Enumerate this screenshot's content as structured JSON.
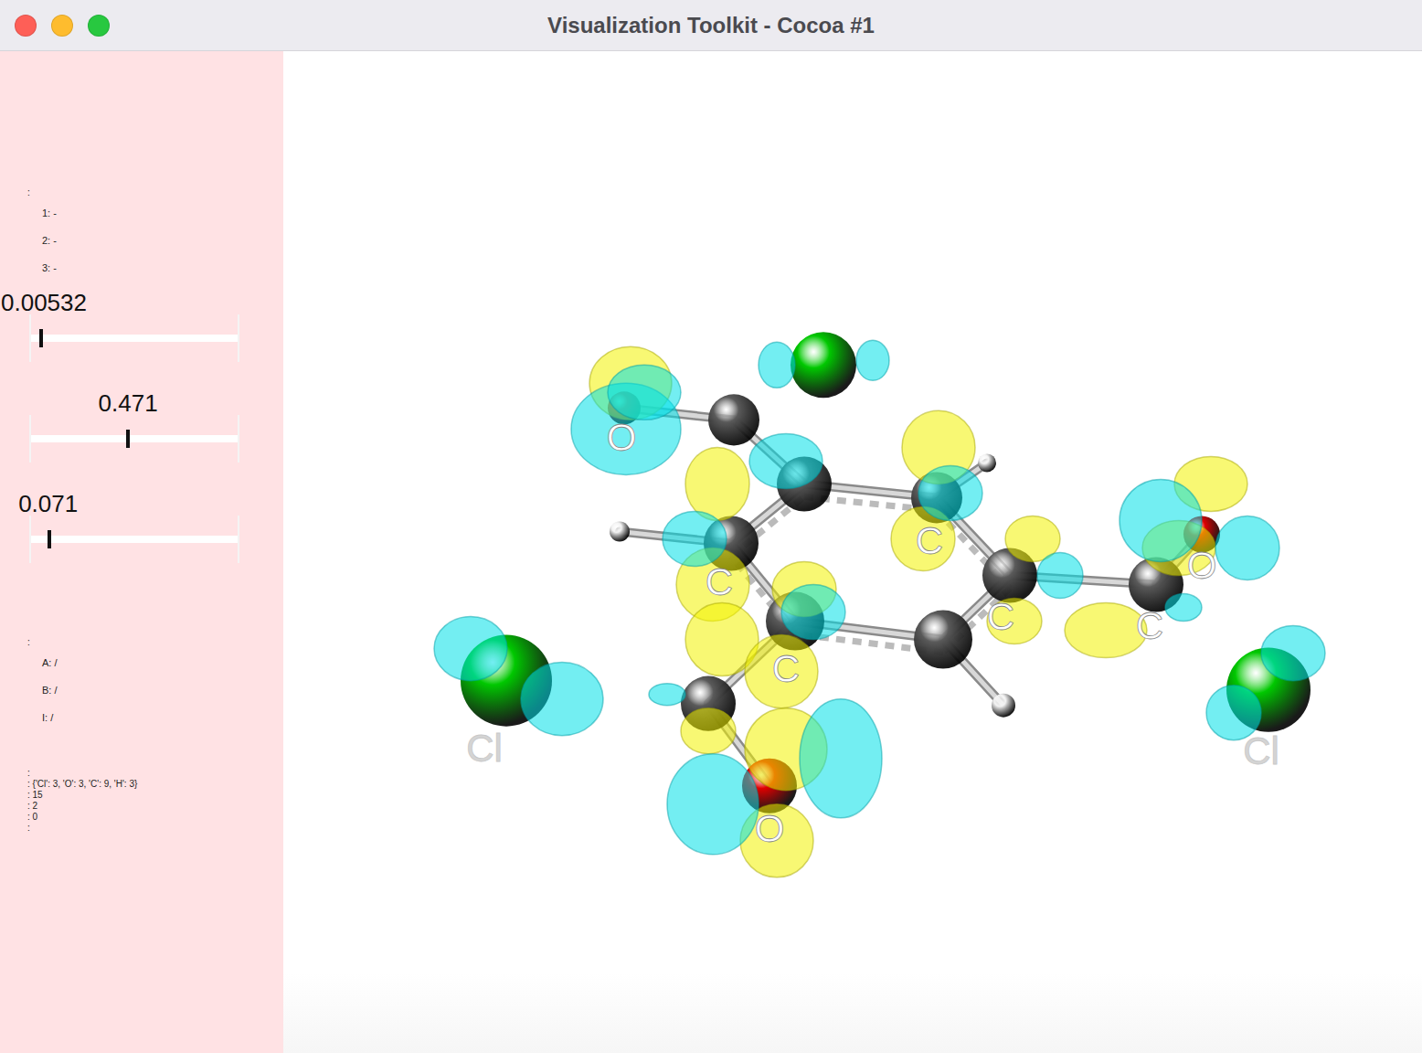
{
  "window": {
    "title": "Visualization Toolkit - Cocoa #1"
  },
  "panel": {
    "group1": {
      "header": ":",
      "items": [
        "1: -",
        "2: -",
        "3: -"
      ]
    },
    "sliders": [
      {
        "value": "0.00532",
        "level": 0.05
      },
      {
        "value": "0.471",
        "level": 0.47
      },
      {
        "value": "0.071",
        "level": 0.09
      }
    ],
    "group2": {
      "header": ":",
      "items": [
        "A: /",
        "B: /",
        "I: /"
      ]
    },
    "info": [
      ":",
      ": {'Cl': 3, 'O': 3, 'C': 9, 'H': 3}",
      ": 15",
      ": 2",
      ": 0",
      ":"
    ]
  },
  "molecule": {
    "atoms": [
      {
        "element": "Cl",
        "label": ""
      },
      {
        "element": "Cl",
        "label": "Cl"
      },
      {
        "element": "Cl",
        "label": "Cl"
      },
      {
        "element": "O",
        "label": "O"
      },
      {
        "element": "O",
        "label": "O"
      },
      {
        "element": "O",
        "label": "O"
      },
      {
        "element": "C",
        "label": ""
      },
      {
        "element": "C",
        "label": "C"
      },
      {
        "element": "C",
        "label": "C"
      },
      {
        "element": "C",
        "label": ""
      },
      {
        "element": "C",
        "label": "C"
      },
      {
        "element": "C",
        "label": "C"
      },
      {
        "element": "C",
        "label": ""
      },
      {
        "element": "C",
        "label": "C"
      },
      {
        "element": "C",
        "label": ""
      },
      {
        "element": "H",
        "label": ""
      },
      {
        "element": "H",
        "label": ""
      },
      {
        "element": "H",
        "label": ""
      }
    ]
  }
}
